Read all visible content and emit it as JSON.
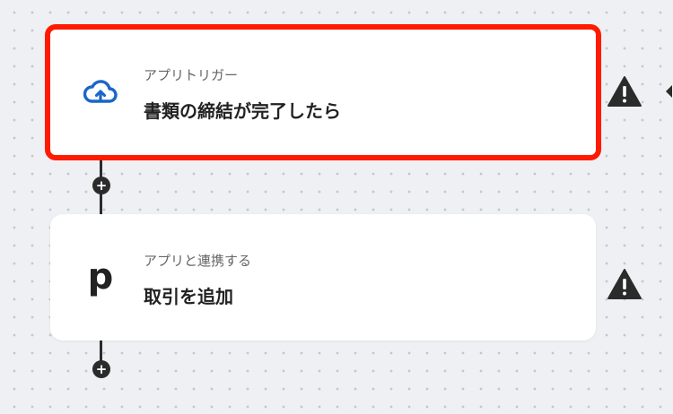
{
  "flow": {
    "steps": [
      {
        "category": "アプリトリガー",
        "title": "書類の締結が完了したら",
        "icon": "cloud-sign-icon",
        "selected": true,
        "status": "warning"
      },
      {
        "category": "アプリと連携する",
        "title": "取引を追加",
        "icon": "p-logo",
        "logo_text": "p",
        "selected": false,
        "status": "warning"
      }
    ],
    "add_step_symbol": "+"
  },
  "colors": {
    "selection_border": "#ff1a00",
    "cloud_icon": "#1a66c9",
    "warning_icon": "#2b2b2b",
    "connector": "#2b2b2b",
    "canvas_background": "#eef0f3"
  }
}
